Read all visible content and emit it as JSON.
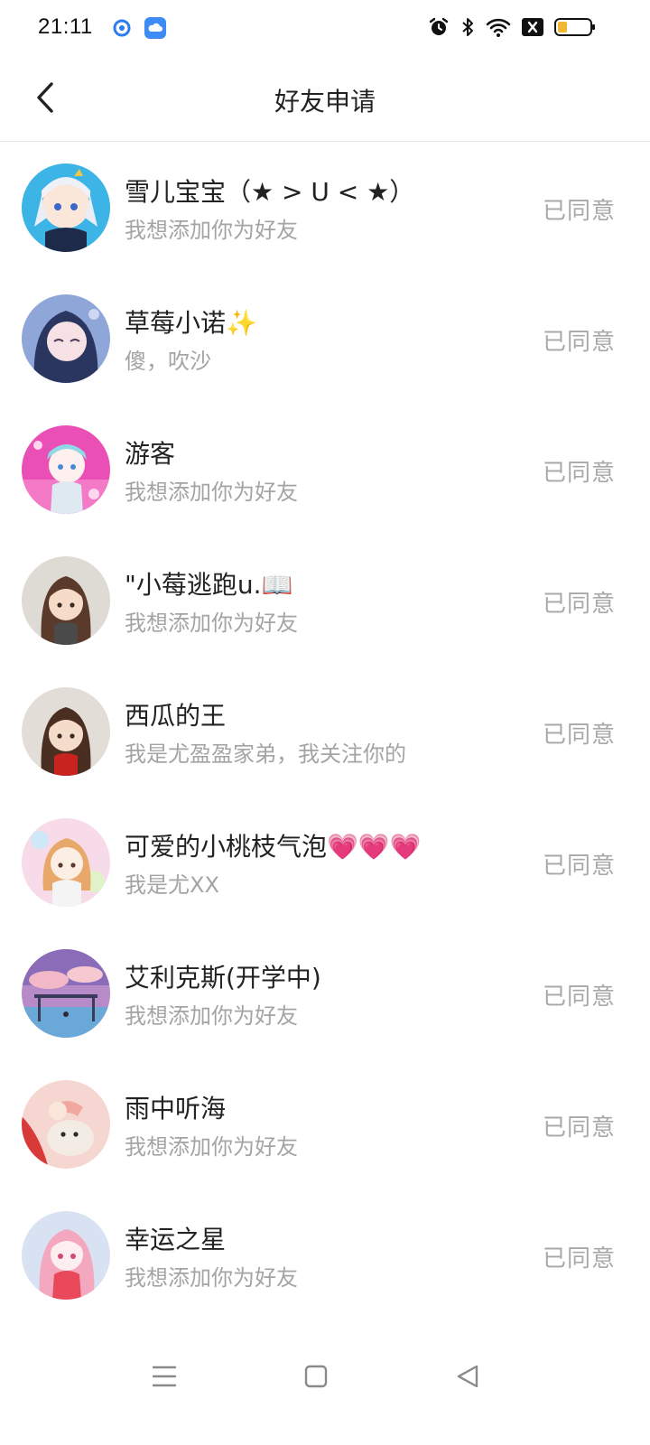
{
  "status_bar": {
    "time": "21:11",
    "notification_icons": [
      "target-icon",
      "cloud-app-icon"
    ],
    "system_icons": [
      "alarm-icon",
      "bluetooth-icon",
      "wifi-icon",
      "sim-off-icon",
      "battery-icon"
    ],
    "battery_level": 0.3
  },
  "header": {
    "title": "好友申请",
    "back_icon": "chevron-left-icon"
  },
  "requests": [
    {
      "name": "雪儿宝宝（★ > U < ★）",
      "message": "我想添加你为好友",
      "status": "已同意"
    },
    {
      "name": "草莓小诺✨",
      "message": "傻，吹沙",
      "status": "已同意"
    },
    {
      "name": "游客",
      "message": "我想添加你为好友",
      "status": "已同意"
    },
    {
      "name": "\"小莓逃跑u.📖",
      "message": "我想添加你为好友",
      "status": "已同意"
    },
    {
      "name": "西瓜的王",
      "message": "我是尤盈盈家弟，我关注你的",
      "status": "已同意"
    },
    {
      "name": "可爱的小桃枝气泡💗💗💗",
      "message": "我是尤XX",
      "status": "已同意"
    },
    {
      "name": "艾利克斯(开学中)",
      "message": "我想添加你为好友",
      "status": "已同意"
    },
    {
      "name": "雨中听海",
      "message": "我想添加你为好友",
      "status": "已同意"
    },
    {
      "name": "幸运之星",
      "message": "我想添加你为好友",
      "status": "已同意"
    }
  ],
  "nav_bar": {
    "icons": [
      "menu-icon",
      "home-square-icon",
      "back-triangle-icon"
    ]
  },
  "colors": {
    "status_text": "#a8a8a8",
    "message_text": "#a4a4a4",
    "name_text": "#222222",
    "divider": "#e6e6e6"
  }
}
